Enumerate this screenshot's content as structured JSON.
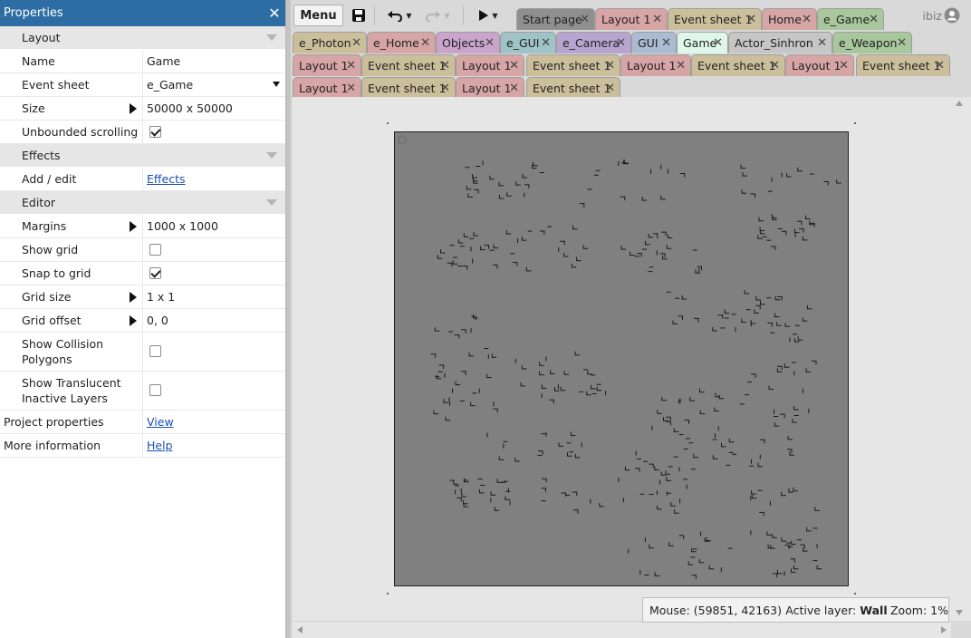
{
  "panel": {
    "title": "Properties",
    "sections": {
      "layout": "Layout",
      "effects": "Effects",
      "editor": "Editor"
    },
    "rows": {
      "name": {
        "label": "Name",
        "value": "Game"
      },
      "event_sheet": {
        "label": "Event sheet",
        "value": "e_Game"
      },
      "size": {
        "label": "Size",
        "value": "50000 x 50000"
      },
      "unbounded_scrolling": {
        "label": "Unbounded scrolling",
        "checked": true
      },
      "add_edit": {
        "label": "Add / edit",
        "link": "Effects"
      },
      "margins": {
        "label": "Margins",
        "value": "1000 x 1000"
      },
      "show_grid": {
        "label": "Show grid",
        "checked": false
      },
      "snap_to_grid": {
        "label": "Snap to grid",
        "checked": true
      },
      "grid_size": {
        "label": "Grid size",
        "value": "1 x 1"
      },
      "grid_offset": {
        "label": "Grid offset",
        "value": "0, 0"
      },
      "show_collision": {
        "label_1": "Show Collision",
        "label_2": "Polygons",
        "checked": false
      },
      "show_translucent": {
        "label_1": "Show Translucent",
        "label_2": "Inactive Layers",
        "checked": false
      },
      "project_properties": {
        "label": "Project properties",
        "link": "View"
      },
      "more_information": {
        "label": "More information",
        "link": "Help"
      }
    }
  },
  "toolbar": {
    "menu_label": "Menu",
    "user_name": "ibiz"
  },
  "tabs": [
    {
      "label": "Start page",
      "color": "#8f8f8f"
    },
    {
      "label": "Layout 1",
      "color": "#d7a5a5"
    },
    {
      "label": "Event sheet 1",
      "color": "#cbbf9b"
    },
    {
      "label": "Home",
      "color": "#d7a5a5"
    },
    {
      "label": "e_Game",
      "color": "#a9c79c"
    },
    {
      "label": "e_Photon",
      "color": "#cbbf9b"
    },
    {
      "label": "e_Home",
      "color": "#d7a5a5"
    },
    {
      "label": "Objects",
      "color": "#c9a5cc"
    },
    {
      "label": "e_GUI",
      "color": "#9fc3c7"
    },
    {
      "label": "e_Camera",
      "color": "#b7a5d0"
    },
    {
      "label": "GUI",
      "color": "#aabbd2"
    },
    {
      "label": "Game",
      "color": "#dff7ea"
    },
    {
      "label": "Actor_Sinhron",
      "color": "#c6c6c6"
    },
    {
      "label": "e_Weapon",
      "color": "#a9c79c"
    },
    {
      "label": "Layout 1",
      "color": "#d7a5a5"
    },
    {
      "label": "Event sheet 1",
      "color": "#cbbf9b"
    },
    {
      "label": "Layout 1",
      "color": "#d7a5a5"
    },
    {
      "label": "Event sheet 1",
      "color": "#cbbf9b"
    },
    {
      "label": "Layout 1",
      "color": "#d7a5a5"
    },
    {
      "label": "Event sheet 1",
      "color": "#cbbf9b"
    },
    {
      "label": "Layout 1",
      "color": "#d7a5a5"
    },
    {
      "label": "Event sheet 1",
      "color": "#cbbf9b"
    },
    {
      "label": "Layout 1",
      "color": "#d7a5a5"
    },
    {
      "label": "Event sheet 1",
      "color": "#cbbf9b"
    },
    {
      "label": "Layout 1",
      "color": "#d7a5a5"
    },
    {
      "label": "Event sheet 1",
      "color": "#cbbf9b"
    }
  ],
  "status": {
    "mouse": "Mouse: (59851, 42163)",
    "active_layer_label": "Active layer:",
    "active_layer_value": "Wall",
    "zoom": "Zoom: 1%"
  }
}
